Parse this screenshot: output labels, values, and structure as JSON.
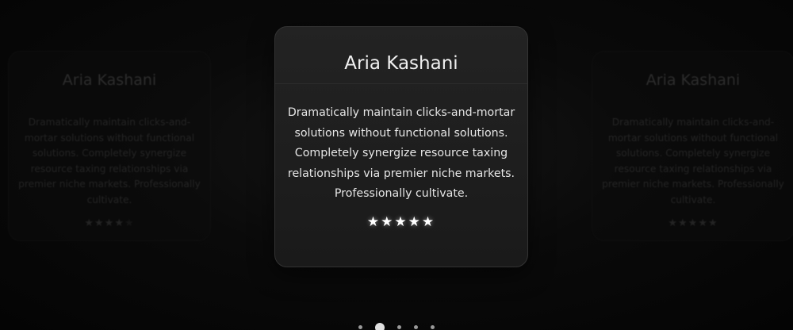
{
  "carousel": {
    "cards": [
      {
        "name": "Aria Kashani",
        "quote": "Dramatically maintain clicks-and-mortar solutions without functional solutions. Completely synergize resource taxing relationships via premier niche markets. Professionally cultivate.",
        "rating": 4,
        "max_rating": 5
      },
      {
        "name": "Aria Kashani",
        "quote": "Dramatically maintain clicks-and-mortar solutions without functional solutions. Completely synergize resource taxing relationships via premier niche markets. Professionally cultivate.",
        "rating": 5,
        "max_rating": 5
      },
      {
        "name": "Aria Kashani",
        "quote": "Dramatically maintain clicks-and-mortar solutions without functional solutions. Completely synergize resource taxing relationships via premier niche markets. Professionally cultivate.",
        "rating": 5,
        "max_rating": 5
      }
    ],
    "star_icon": "star-icon",
    "pagination": {
      "count": 5,
      "active": 1
    }
  },
  "colors": {
    "star_active": "#ffffff",
    "background": "#050505"
  }
}
